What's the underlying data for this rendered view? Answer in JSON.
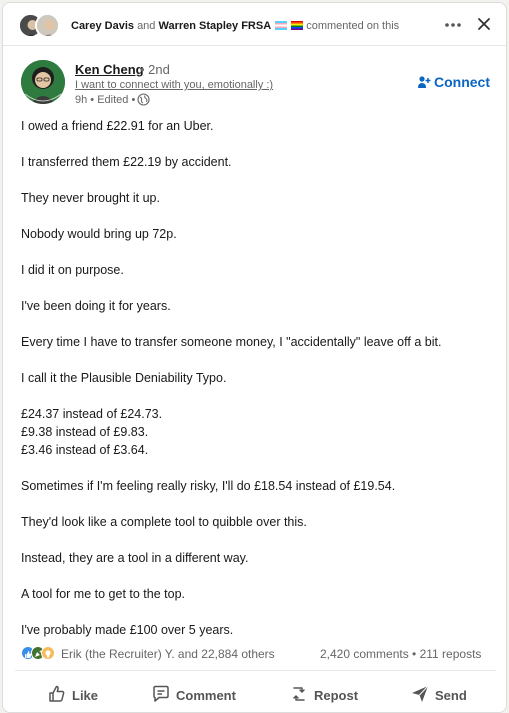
{
  "header": {
    "actor1": "Carey Davis",
    "conjunction": "and",
    "actor2": "Warren Stapley FRSA",
    "action": "commented on this",
    "more_icon": "ellipsis-icon",
    "close_icon": "close-icon"
  },
  "author": {
    "name": "Ken Cheng",
    "degree": "• 2nd",
    "headline": "I want to connect with you, emotionally :)",
    "meta": "9h • Edited •",
    "visibility_icon": "globe-icon",
    "connect_label": "Connect"
  },
  "post": {
    "lines": [
      "I owed a friend £22.91 for an Uber.",
      "I transferred them £22.19 by accident.",
      "They never brought it up.",
      "Nobody would bring up 72p.",
      "I did it on purpose.",
      "I've been doing it for years.",
      "Every time I have to transfer someone money, I \"accidentally\" leave off a bit.",
      "I call it the Plausible Deniability Typo.",
      "£24.37 instead of £24.73.",
      "£9.38 instead of £9.83.",
      "£3.46 instead of £3.64.",
      "Sometimes if I'm feeling really risky, I'll do £18.54 instead of £19.54.",
      "They'd look like a complete tool to quibble over this.",
      "Instead, they are a tool in a different way.",
      "A tool for me to get to the top.",
      "I've probably made £100 over 5 years."
    ]
  },
  "social": {
    "reactors": "Erik (the Recruiter) Y. and 22,884 others",
    "counts": "2,420 comments • 211 reposts",
    "reaction_icons": [
      "like-icon",
      "celebrate-icon",
      "insightful-icon"
    ]
  },
  "actions": {
    "like": "Like",
    "comment": "Comment",
    "repost": "Repost",
    "send": "Send"
  },
  "colors": {
    "accent": "#0a66c2",
    "text": "#191919",
    "muted": "#666666"
  }
}
